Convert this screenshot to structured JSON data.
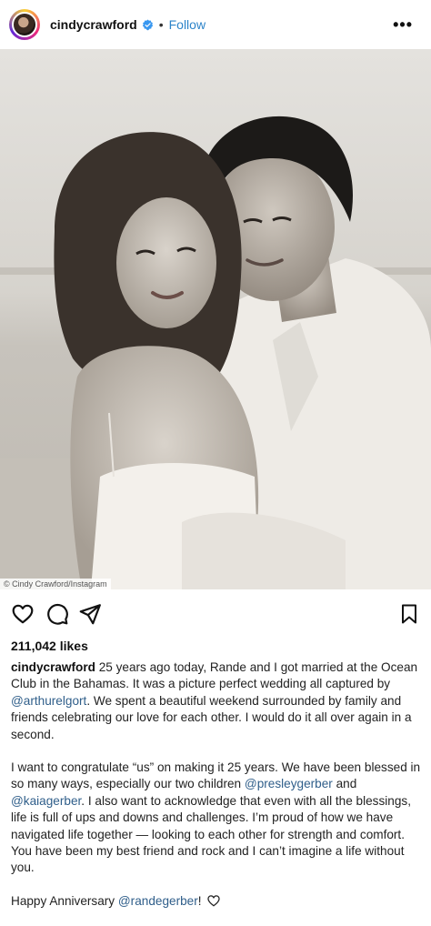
{
  "header": {
    "username": "cindycrawford",
    "separator": "•",
    "follow_label": "Follow",
    "more_label": "•••"
  },
  "post": {
    "photo_alt": "Black and white wedding portrait of a couple embracing on a beach",
    "likes": "211,042 likes"
  },
  "caption": {
    "username": "cindycrawford",
    "p1_a": " 25 years ago today, Rande and I got married at the Ocean Club in the Bahamas. It was a picture perfect wedding all captured by ",
    "p1_mention": "@arthurelgort",
    "p1_b": ". We spent a beautiful weekend surrounded by family and friends celebrating our love for each other. I would do it all over again in a second.",
    "p2_a": "I want to congratulate “us” on making it 25 years. We have been blessed in so many ways, especially our two children ",
    "p2_mention1": "@presleygerber",
    "p2_mid": " and ",
    "p2_mention2": "@kaiagerber",
    "p2_b": ". I also want to acknowledge that even with all the blessings, life is full of ups and downs and challenges. I’m proud of how we have navigated life together — looking to each other for strength and comfort. You have been my best friend and rock and I can’t imagine a life without you.",
    "p3_a": "Happy Anniversary ",
    "p3_mention": "@randegerber",
    "p3_b": "! "
  },
  "credit": "© Cindy Crawford/Instagram",
  "colors": {
    "follow": "#2d84c9",
    "mention": "#2f5e8a",
    "verified": "#3897f0"
  }
}
